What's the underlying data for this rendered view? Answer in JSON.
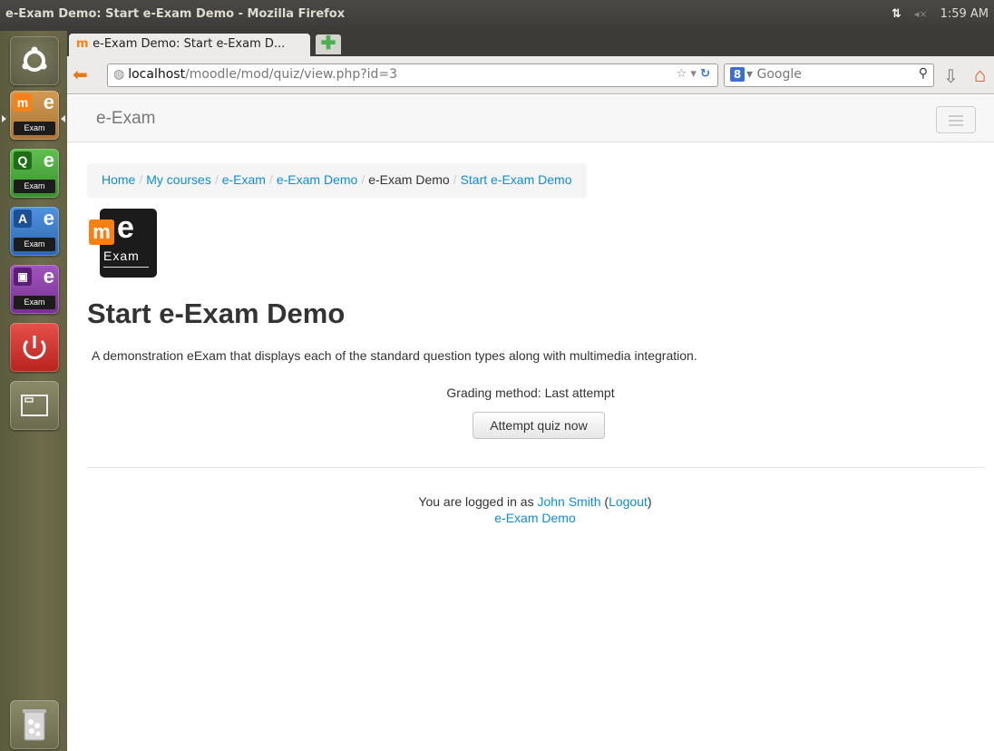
{
  "os_panel": {
    "window_title": "e-Exam Demo: Start e-Exam Demo - Mozilla Firefox",
    "network_icon": "⇅",
    "volume_icon": "◂×",
    "clock": "1:59 AM"
  },
  "launcher": {
    "items": [
      {
        "name": "ubuntu-dash",
        "letter": "",
        "bg": "#dd4814"
      },
      {
        "name": "moodle-exam",
        "letter": "m",
        "bg": "#c68a3c"
      },
      {
        "name": "quiz-exam",
        "letter": "Q",
        "bg": "#4caf3d"
      },
      {
        "name": "a-exam",
        "letter": "A",
        "bg": "#3a7fcf"
      },
      {
        "name": "tv-exam",
        "letter": "▣",
        "bg": "#8e3fa8"
      }
    ],
    "exam_label": "Exam",
    "e_label": "e"
  },
  "browser": {
    "tab_favicon": "m",
    "tab_title": "e-Exam Demo: Start e-Exam D...",
    "url_host": "localhost",
    "url_path": "/moodle/mod/quiz/view.php?id=3",
    "search_placeholder": "Google",
    "search_engine_letter": "8"
  },
  "moodle": {
    "brand": "e-Exam",
    "breadcrumb": {
      "home": "Home",
      "my_courses": "My courses",
      "category": "e-Exam",
      "course": "e-Exam Demo",
      "section": "e-Exam Demo",
      "current": "Start e-Exam Demo"
    },
    "logo": {
      "m": "m",
      "e": "e",
      "exam": "Exam"
    },
    "title": "Start e-Exam Demo",
    "intro": "A demonstration eExam that displays each of the standard question types along with multimedia integration.",
    "grading": "Grading method: Last attempt",
    "attempt_button": "Attempt quiz now",
    "footer": {
      "logged_in_prefix": "You are logged in as ",
      "user": "John Smith",
      "open_paren": " (",
      "logout": "Logout",
      "close_paren": ")",
      "course_link": "e-Exam Demo"
    }
  }
}
